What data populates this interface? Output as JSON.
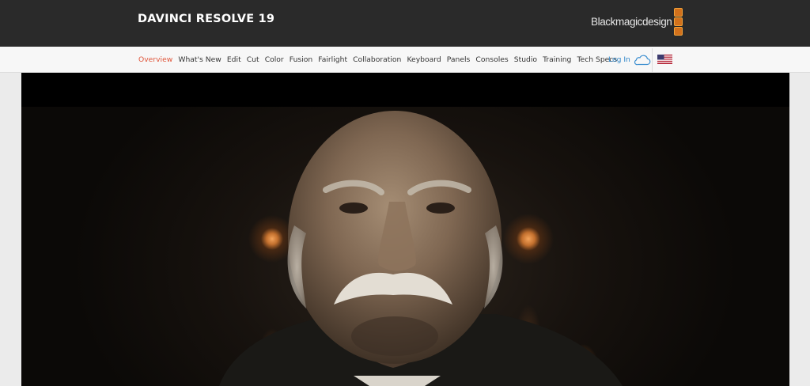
{
  "header": {
    "product_title": "DAVINCI RESOLVE 19",
    "brand_text": "Blackmagicdesign"
  },
  "nav": {
    "items": [
      {
        "label": "Overview",
        "active": true
      },
      {
        "label": "What's New",
        "active": false
      },
      {
        "label": "Edit",
        "active": false
      },
      {
        "label": "Cut",
        "active": false
      },
      {
        "label": "Color",
        "active": false
      },
      {
        "label": "Fusion",
        "active": false
      },
      {
        "label": "Fairlight",
        "active": false
      },
      {
        "label": "Collaboration",
        "active": false
      },
      {
        "label": "Keyboard",
        "active": false
      },
      {
        "label": "Panels",
        "active": false
      },
      {
        "label": "Consoles",
        "active": false
      },
      {
        "label": "Studio",
        "active": false
      },
      {
        "label": "Training",
        "active": false
      },
      {
        "label": "Tech Specs",
        "active": false
      }
    ],
    "login_label": "Log In",
    "login_icon": "cloud-icon",
    "region_icon": "us-flag-icon"
  },
  "colors": {
    "topbar_bg": "#2a2a2a",
    "nav_bg": "#f7f7f7",
    "nav_active": "#e0553a",
    "login_blue": "#2f86c9",
    "brand_orange": "#d2711c"
  },
  "hero": {
    "content": "video-still"
  }
}
